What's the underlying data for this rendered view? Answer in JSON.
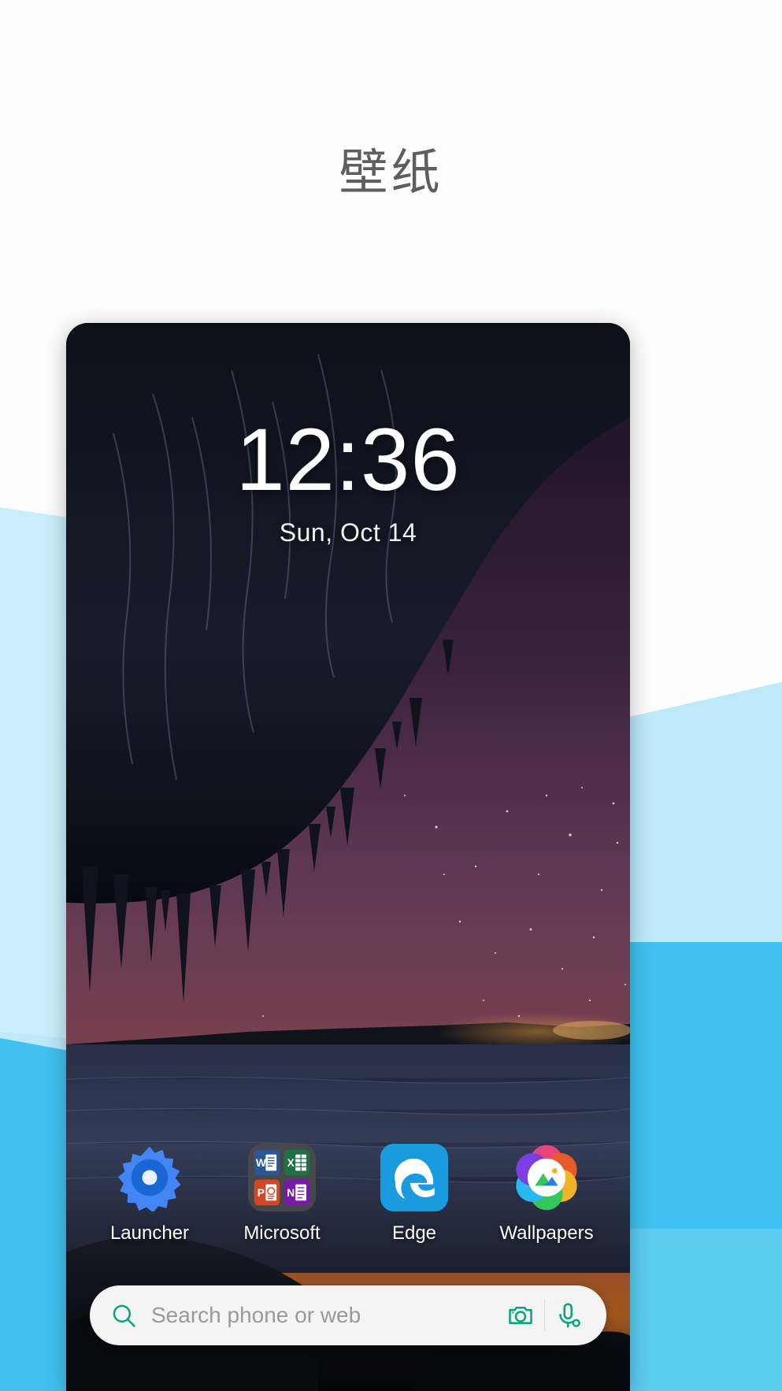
{
  "page": {
    "title": "壁纸",
    "title_color": "#5e5e5e",
    "background_color": "#ffffff"
  },
  "decor": {
    "light_blue": "#bde9f9",
    "bright_blue": "#3fc2ef",
    "mid_blue": "#5ccdf2"
  },
  "phone": {
    "lockscreen": {
      "time": "12:36",
      "date": "Sun, Oct 14"
    },
    "dock": {
      "apps": [
        {
          "label": "Launcher",
          "icon": "gear-icon",
          "color": "#3b78e7"
        },
        {
          "label": "Microsoft",
          "icon": "folder-office-icon",
          "color": "#4a4a4a"
        },
        {
          "label": "Edge",
          "icon": "edge-icon",
          "color": "#1a9be0"
        },
        {
          "label": "Wallpapers",
          "icon": "wallpapers-icon",
          "color": "#e8447a"
        }
      ],
      "office_apps": [
        {
          "name": "Word",
          "letter": "W",
          "color": "#2b5797"
        },
        {
          "name": "Excel",
          "letter": "X",
          "color": "#1e7145"
        },
        {
          "name": "PowerPoint",
          "letter": "P",
          "color": "#d24726"
        },
        {
          "name": "OneNote",
          "letter": "N",
          "color": "#7719aa"
        }
      ]
    },
    "search": {
      "placeholder": "Search phone or web",
      "value": "",
      "accent_color": "#0aa47f",
      "search_icon": "search-icon",
      "camera_icon": "camera-icon",
      "mic_icon": "microphone-icon"
    }
  }
}
